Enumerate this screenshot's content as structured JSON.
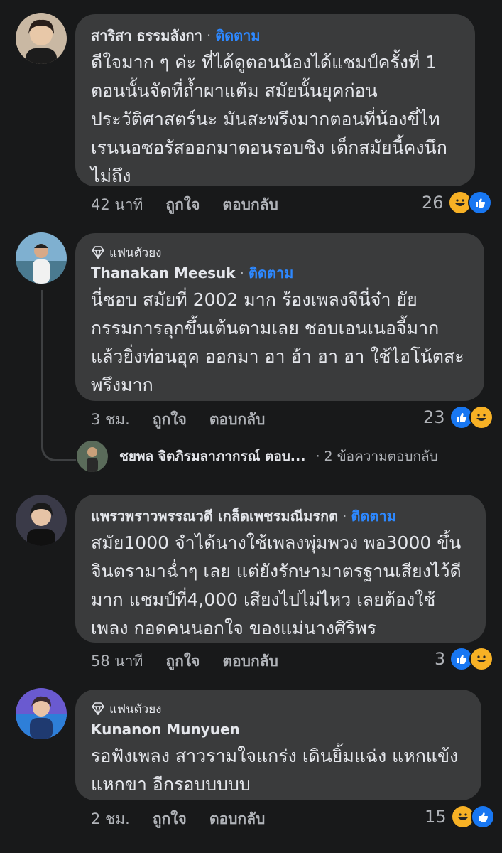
{
  "comments": [
    {
      "badge": "",
      "name": "สาริสา ธรรมลังกา",
      "follow": "ติดตาม",
      "text": "ดีใจมาก ๆ ค่ะ ที่ได้ดูตอนน้องได้แชมป์ครั้งที่ 1 ตอนนั้นจัดที่ถ้ำผาแต้ม สมัยนั้นยุคก่อนประวัติศาสตร์นะ มันสะพรึงมากตอนที่น้องขี่ไทเรนนอซอรัสออกมาตอนรอบชิง เด็กสมัยนี้คงนึกไม่ถึง",
      "time": "42 นาที",
      "like": "ถูกใจ",
      "reply": "ตอบกลับ",
      "count": "26"
    },
    {
      "badge": "แฟนตัวยง",
      "name": "Thanakan Meesuk",
      "follow": "ติดตาม",
      "text": "นี่ชอบ สมัยที่ 2002 มาก ร้องเพลงจีนี่จ๋า ยัยกรรมการลุกขึ้นเต้นตามเลย ชอบเอนเนอจี้มาก แล้วยิ่งท่อนฮุค ออกมา อา ฮ้า ฮา ฮา ใช้ไฮโน้ตสะพรึงมาก",
      "time": "3 ชม.",
      "like": "ถูกใจ",
      "reply": "ตอบกลับ",
      "count": "23"
    },
    {
      "badge": "",
      "name": "แพรวพราวพรรณวดี เกล็ดเพชรมณีมรกต",
      "follow": "ติดตาม",
      "text": "สมัย1000 จำได้นางใช้เพลงพุ่มพวง พอ3000 ขึ้นจินตรามาฉ่ำๆ เลย แต่ยังรักษามาตรฐานเสียงไว้ดีมาก แชมป์ที่4,000 เสียงไปไม่ไหว เลยต้องใช้เพลง กอดคนนอกใจ ของแม่นางศิริพร",
      "time": "58 นาที",
      "like": "ถูกใจ",
      "reply": "ตอบกลับ",
      "count": "3"
    },
    {
      "badge": "แฟนตัวยง",
      "name": "Kunanon Munyuen",
      "follow": "",
      "text": "รอฟังเพลง สาวรามใจแกร่ง เดินยิ้มแฉ่ง แหกแข้งแหกขา อีกรอบบบบบ",
      "time": "2 ชม.",
      "like": "ถูกใจ",
      "reply": "ตอบกลับ",
      "count": "15"
    }
  ],
  "reply_thread": {
    "name": "ชยพล จิตภิรมลาภากรณ์ ตอบ...",
    "count": "· 2 ข้อความตอบกลับ"
  },
  "colors": {
    "bubble": "#3a3b3c",
    "background": "#18191a",
    "follow": "#2d88ff"
  }
}
